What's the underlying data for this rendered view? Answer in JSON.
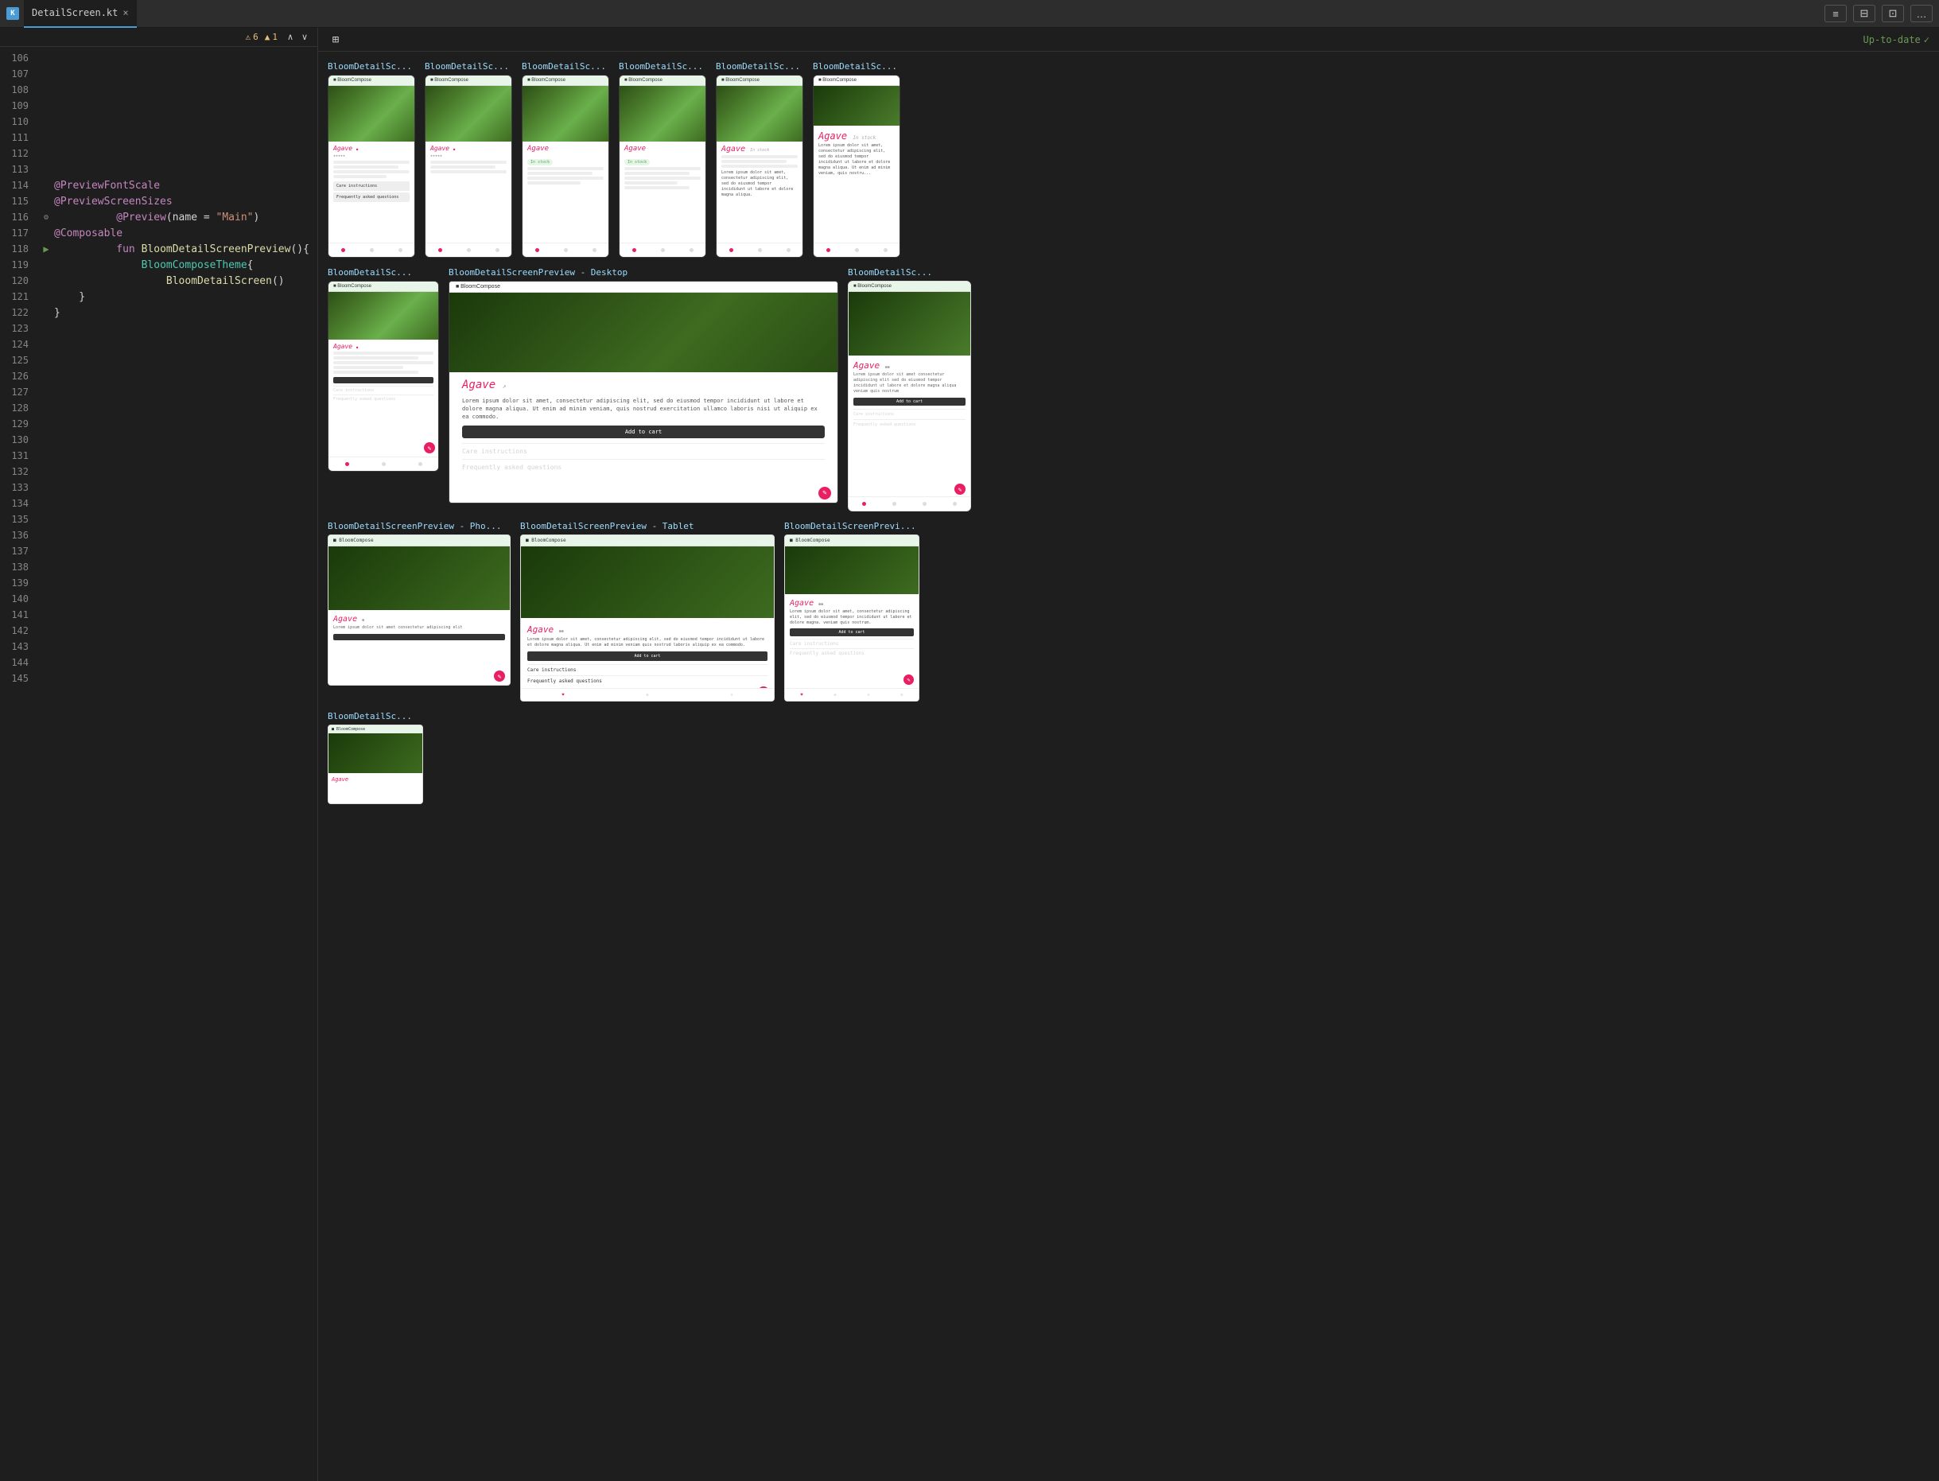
{
  "titleBar": {
    "icon": "KT",
    "fileName": "DetailScreen.kt",
    "closeLabel": "×"
  },
  "toolbar": {
    "warningCount": "6",
    "warningIcon": "⚠",
    "infoCount": "1",
    "infoIcon": "▲",
    "upArrow": "∧",
    "downArrow": "∨",
    "gridIcon": "⊞",
    "upToDate": "Up-to-date",
    "checkIcon": "✓",
    "buttons": [
      "≡",
      "⊟",
      "⊡",
      "…"
    ]
  },
  "codeLines": [
    {
      "num": "106",
      "content": "",
      "type": "empty"
    },
    {
      "num": "107",
      "content": "",
      "type": "empty"
    },
    {
      "num": "108",
      "content": "",
      "type": "empty"
    },
    {
      "num": "109",
      "content": "",
      "type": "empty"
    },
    {
      "num": "110",
      "content": "",
      "type": "empty"
    },
    {
      "num": "111",
      "content": "",
      "type": "empty"
    },
    {
      "num": "112",
      "content": "",
      "type": "empty"
    },
    {
      "num": "113",
      "content": "",
      "type": "empty"
    },
    {
      "num": "114",
      "content": "@PreviewFontScale",
      "type": "annotation"
    },
    {
      "num": "115",
      "content": "@PreviewScreenSizes",
      "type": "annotation"
    },
    {
      "num": "116",
      "content": "@Preview(name = \"Main\")",
      "type": "annotation",
      "hasGear": true
    },
    {
      "num": "117",
      "content": "@Composable",
      "type": "annotation"
    },
    {
      "num": "118",
      "content": "fun BloomDetailScreenPreview(){",
      "type": "function",
      "hasPlay": true
    },
    {
      "num": "119",
      "content": "    BloomComposeTheme{",
      "type": "code"
    },
    {
      "num": "120",
      "content": "        BloomDetailScreen()",
      "type": "code"
    },
    {
      "num": "121",
      "content": "    }",
      "type": "code"
    },
    {
      "num": "122",
      "content": "}",
      "type": "code"
    },
    {
      "num": "123",
      "content": "",
      "type": "empty"
    },
    {
      "num": "124",
      "content": "",
      "type": "empty"
    },
    {
      "num": "125",
      "content": "",
      "type": "empty"
    },
    {
      "num": "126",
      "content": "",
      "type": "empty"
    },
    {
      "num": "127",
      "content": "",
      "type": "empty"
    },
    {
      "num": "128",
      "content": "",
      "type": "empty"
    },
    {
      "num": "129",
      "content": "",
      "type": "empty"
    },
    {
      "num": "130",
      "content": "",
      "type": "empty"
    },
    {
      "num": "131",
      "content": "",
      "type": "empty"
    },
    {
      "num": "132",
      "content": "",
      "type": "empty"
    },
    {
      "num": "133",
      "content": "",
      "type": "empty"
    },
    {
      "num": "134",
      "content": "",
      "type": "empty"
    },
    {
      "num": "135",
      "content": "",
      "type": "empty"
    },
    {
      "num": "136",
      "content": "",
      "type": "empty"
    },
    {
      "num": "137",
      "content": "",
      "type": "empty"
    },
    {
      "num": "138",
      "content": "",
      "type": "empty"
    },
    {
      "num": "139",
      "content": "",
      "type": "empty"
    },
    {
      "num": "140",
      "content": "",
      "type": "empty"
    },
    {
      "num": "141",
      "content": "",
      "type": "empty"
    },
    {
      "num": "142",
      "content": "",
      "type": "empty"
    },
    {
      "num": "143",
      "content": "",
      "type": "empty"
    },
    {
      "num": "144",
      "content": "",
      "type": "empty"
    },
    {
      "num": "145",
      "content": "",
      "type": "empty"
    }
  ],
  "previewItems": {
    "row1": [
      {
        "label": "BloomDetailSc...",
        "size": "small"
      },
      {
        "label": "BloomDetailSc...",
        "size": "small"
      },
      {
        "label": "BloomDetailSc...",
        "size": "small"
      },
      {
        "label": "BloomDetailSc...",
        "size": "small"
      },
      {
        "label": "BloomDetailSc...",
        "size": "small"
      },
      {
        "label": "BloomDetailSc...",
        "size": "small"
      }
    ],
    "row2": [
      {
        "label": "BloomDetailSc...",
        "size": "small"
      },
      {
        "label": "BloomDetailScreenPreview - Desktop",
        "size": "desktop"
      },
      {
        "label": "BloomDetailSc...",
        "size": "large"
      }
    ],
    "row3": [
      {
        "label": "BloomDetailScreenPreview - Pho...",
        "size": "phone"
      },
      {
        "label": "BloomDetailScreenPreview - Tablet",
        "size": "tablet"
      },
      {
        "label": "BloomDetailScreenPrevi...",
        "size": "large2"
      }
    ],
    "row4": [
      {
        "label": "BloomDetailSc...",
        "size": "small"
      }
    ]
  },
  "plantName": "Agave",
  "inStock": "In Stock",
  "careInstructions": "Care instructions",
  "faq": "Frequently asked questions",
  "bloomCompose": "BloomCompose",
  "addToCart": "Add to cart"
}
